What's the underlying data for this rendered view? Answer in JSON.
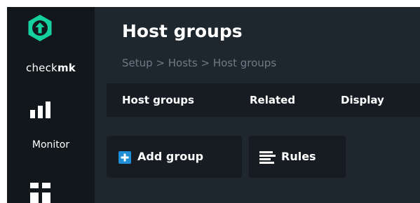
{
  "sidebar": {
    "brand": {
      "prefix": "check",
      "suffix": "mk"
    },
    "monitor_label": "Monitor"
  },
  "header": {
    "title": "Host groups",
    "breadcrumb": "Setup > Hosts > Host groups"
  },
  "menubar": {
    "items": [
      "Host groups",
      "Related",
      "Display"
    ]
  },
  "actions": {
    "add_group": "Add group",
    "rules": "Rules"
  },
  "colors": {
    "accent": "#15d1a0",
    "add_icon": "#1e8fd6",
    "background": "#1e262e",
    "sidebar": "#12171c",
    "panel": "#161c22"
  }
}
